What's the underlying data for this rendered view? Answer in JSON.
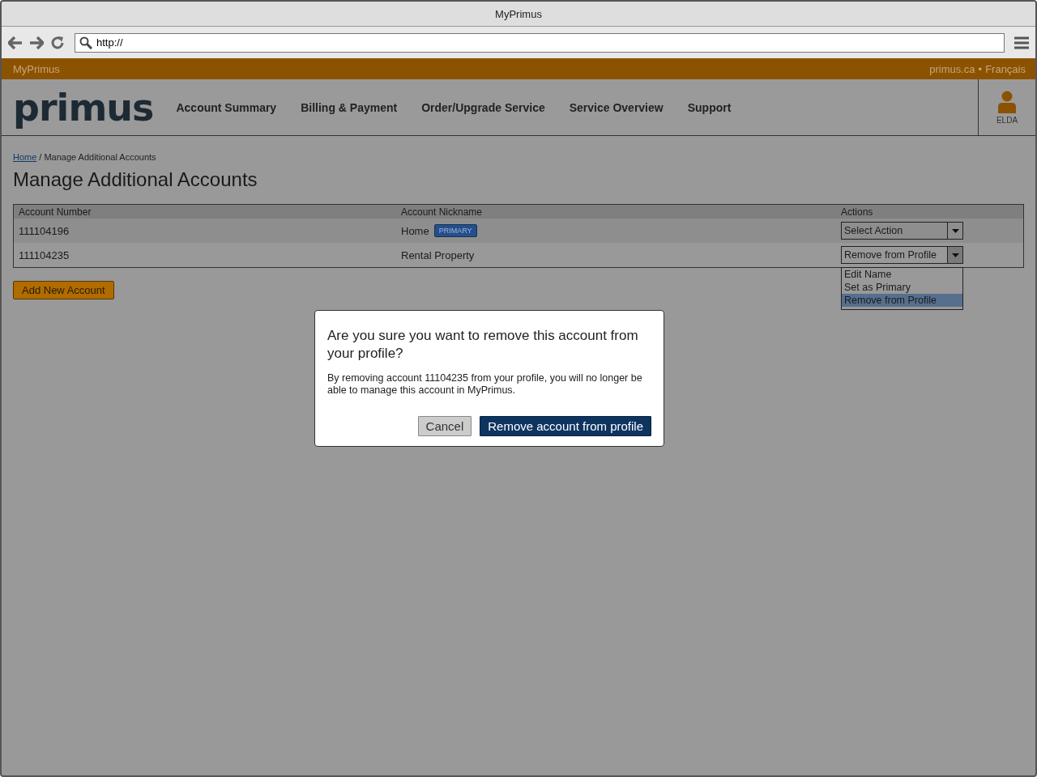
{
  "window": {
    "title": "MyPrimus"
  },
  "browser": {
    "address": "http://"
  },
  "top_bar": {
    "brand": "MyPrimus",
    "links": [
      "primus.ca",
      "Français"
    ],
    "separator": "•"
  },
  "nav": {
    "logo": "primus",
    "items": [
      "Account Summary",
      "Billing & Payment",
      "Order/Upgrade Service",
      "Service Overview",
      "Support"
    ],
    "user": "ELDA"
  },
  "breadcrumb": {
    "items": [
      {
        "label": "Home",
        "link": true
      },
      {
        "label": "Manage Additional Accounts",
        "link": false
      }
    ],
    "separator": "/"
  },
  "page_title": "Manage Additional Accounts",
  "table": {
    "columns": [
      "Account Number",
      "Account Nickname",
      "Actions"
    ],
    "rows": [
      {
        "number": "111104196",
        "nickname": "Home",
        "badge": "PRIMARY",
        "action": "Select Action",
        "expanded": false
      },
      {
        "number": "111104235",
        "nickname": "Rental Property",
        "action": "Remove from Profile",
        "expanded": true,
        "options": [
          {
            "label": "Edit Name",
            "selected": false
          },
          {
            "label": "Set as Primary",
            "selected": false
          },
          {
            "label": "Remove from Profile",
            "selected": true
          }
        ]
      }
    ]
  },
  "add_button": "Add New Account",
  "dialog": {
    "title": "Are you sure you want to remove this account from your profile?",
    "message": "By removing account 11104235 from your profile, you will no longer be able to manage this account in MyPrimus.",
    "buttons": [
      {
        "label": "Cancel",
        "kind": "secondary"
      },
      {
        "label": "Remove account from profile",
        "kind": "primary"
      }
    ]
  }
}
